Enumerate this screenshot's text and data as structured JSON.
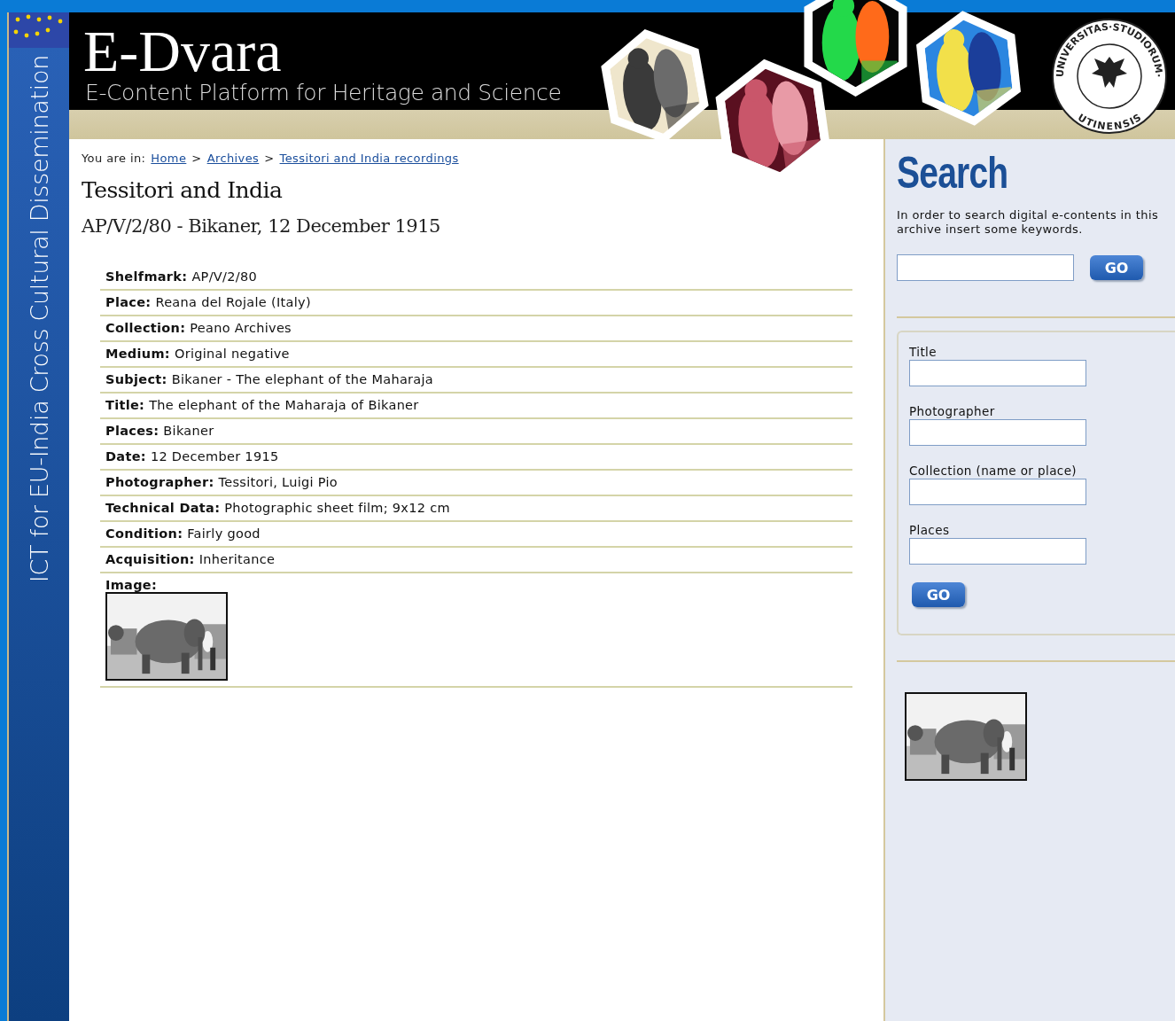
{
  "side_banner": {
    "text": "ICT for EU-India Cross Cultural Dissemination"
  },
  "header": {
    "logo": "E-Dvara",
    "tagline": "E-Content Platform for Heritage and Science",
    "seal_top": "UNIVERSITAS·STUDIORUM·",
    "seal_bottom": "UTINENSIS"
  },
  "breadcrumb": {
    "label": "You are in:",
    "links": [
      "Home",
      "Archives",
      "Tessitori and India recordings"
    ],
    "separator": ">"
  },
  "title": "Tessitori and India",
  "subtitle": "AP/V/2/80 - Bikaner, 12 December 1915",
  "details": [
    {
      "label": "Shelfmark:",
      "value": "AP/V/2/80"
    },
    {
      "label": "Place:",
      "value": "Reana del Rojale (Italy)"
    },
    {
      "label": "Collection:",
      "value": "Peano Archives"
    },
    {
      "label": "Medium:",
      "value": "Original negative"
    },
    {
      "label": "Subject:",
      "value": "Bikaner - The elephant of the Maharaja"
    },
    {
      "label": "Title:",
      "value": "The elephant of the Maharaja of Bikaner"
    },
    {
      "label": "Places:",
      "value": "Bikaner"
    },
    {
      "label": "Date:",
      "value": "12 December 1915"
    },
    {
      "label": "Photographer:",
      "value": "Tessitori, Luigi Pio"
    },
    {
      "label": "Technical Data:",
      "value": "Photographic sheet film; 9x12 cm"
    },
    {
      "label": "Condition:",
      "value": "Fairly good"
    },
    {
      "label": "Acquisition:",
      "value": "Inheritance"
    }
  ],
  "image_row": {
    "label": "Image:",
    "kind": "picture"
  },
  "search": {
    "heading": "Search",
    "intro": "In order to search digital e-contents in this archive insert some keywords.",
    "button": "GO"
  },
  "advanced": {
    "fields": [
      {
        "label": "Title"
      },
      {
        "label": "Photographer"
      },
      {
        "label": "Collection (name or place)"
      },
      {
        "label": "Places"
      }
    ],
    "button": "GO"
  }
}
